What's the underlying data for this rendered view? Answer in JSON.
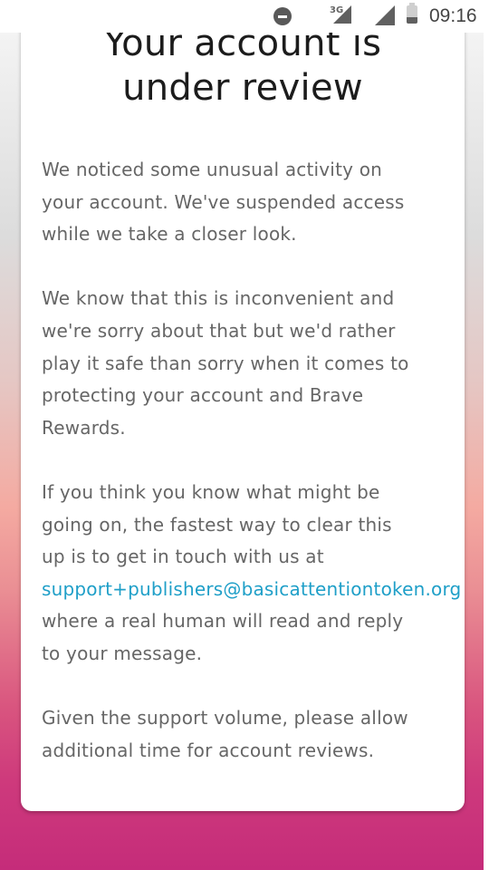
{
  "status_bar": {
    "network_label": "3G",
    "time": "09:16"
  },
  "card": {
    "title_line1": "Your account is",
    "title_line2": "under review",
    "paragraph1": {
      "lines": [
        "We noticed some unusual activity on",
        "your account. We've suspended access",
        "while we take a closer look."
      ]
    },
    "paragraph2": {
      "lines": [
        "We know that this is inconvenient and",
        "we're sorry about that but we'd rather",
        "play it safe than sorry when it comes to",
        "protecting your account and Brave",
        "Rewards."
      ]
    },
    "paragraph3": {
      "lines": [
        "If you think you know what might be",
        "going on, the fastest way to clear this",
        "up is to get in touch with us at"
      ],
      "support_email": "support+publishers@basicattentiontoken.org",
      "after_lines": [
        "where a real human will read and reply",
        "to your message."
      ]
    },
    "paragraph4": {
      "lines": [
        "Given the support volume, please allow",
        "additional time for account reviews."
      ]
    }
  },
  "colors": {
    "link": "#1f9fc8",
    "body_text": "#666666",
    "title_text": "#1c1c1c",
    "gradient_bottom": "#c52c7a"
  }
}
